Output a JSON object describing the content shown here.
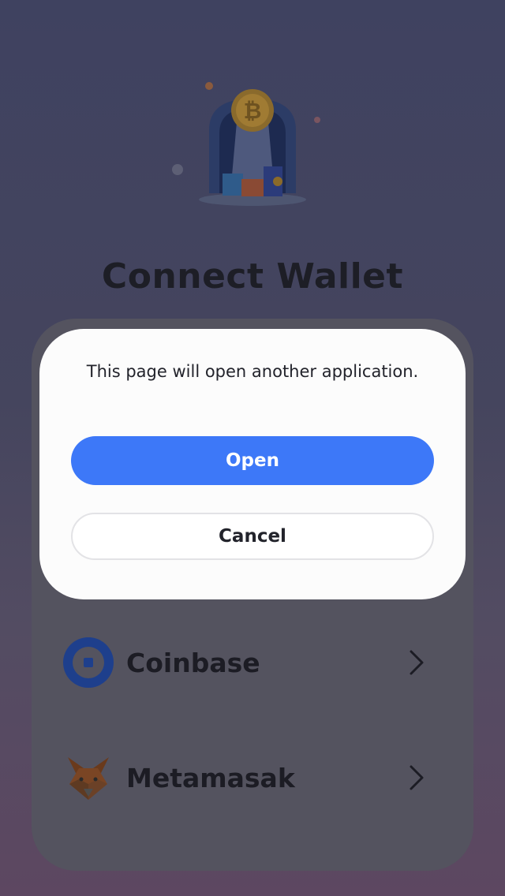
{
  "page": {
    "title": "Connect Wallet"
  },
  "wallets": [
    {
      "name": "Coinbase",
      "icon": "coinbase-logo-icon"
    },
    {
      "name": "Metamasak",
      "icon": "metamask-fox-icon"
    }
  ],
  "dialog": {
    "message": "This page will open another application.",
    "open_label": "Open",
    "cancel_label": "Cancel"
  },
  "colors": {
    "primary": "#3d78f8",
    "coinbase": "#1e3f8c",
    "text_dark": "#1c1c24"
  }
}
